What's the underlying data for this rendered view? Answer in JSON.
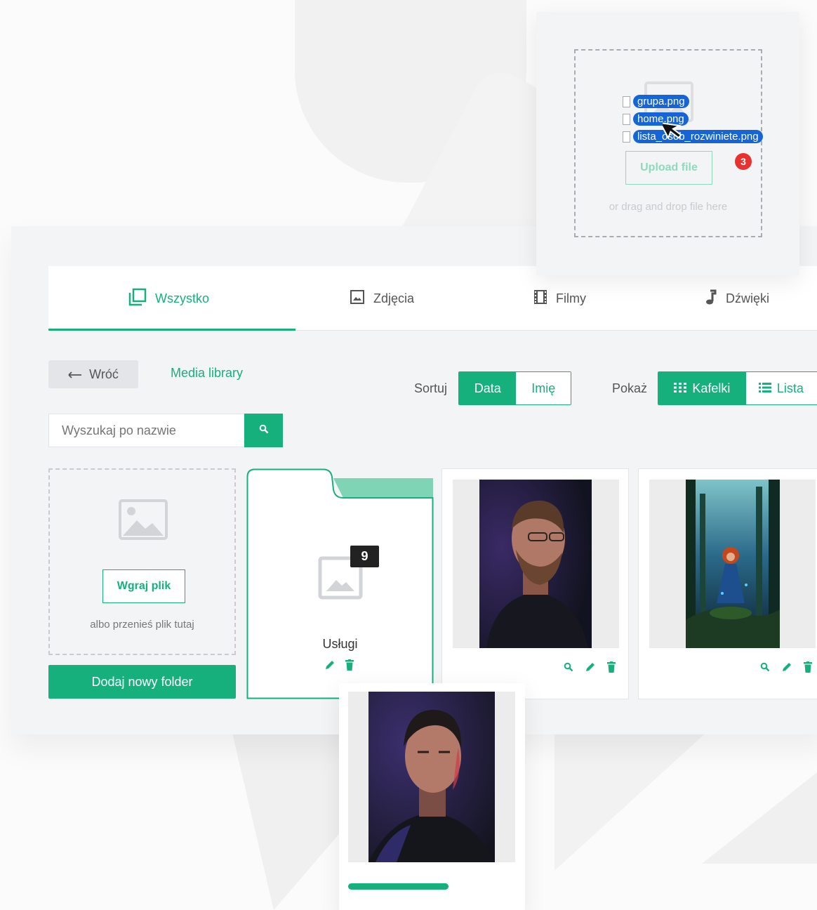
{
  "tabs": [
    {
      "label": "Wszystko",
      "icon": "copy-icon",
      "active": true
    },
    {
      "label": "Zdjęcia",
      "icon": "image-icon",
      "active": false
    },
    {
      "label": "Filmy",
      "icon": "film-icon",
      "active": false
    },
    {
      "label": "Dźwięki",
      "icon": "music-note-icon",
      "active": false
    }
  ],
  "toolbar": {
    "back_label": "Wróć",
    "breadcrumb": "Media library",
    "sort_label": "Sortuj",
    "sort_options": [
      {
        "label": "Data",
        "selected": true
      },
      {
        "label": "Imię",
        "selected": false
      }
    ],
    "show_label": "Pokaż",
    "view_options": [
      {
        "label": "Kafelki",
        "icon": "grid-icon",
        "selected": true
      },
      {
        "label": "Lista",
        "icon": "list-icon",
        "selected": false
      }
    ]
  },
  "search": {
    "placeholder": "Wyszukaj po nazwie",
    "value": ""
  },
  "upload": {
    "button_label": "Wgraj plik",
    "hint": "albo przenieś plik tutaj",
    "add_folder_label": "Dodaj nowy folder"
  },
  "folder": {
    "name": "Usługi",
    "count": "9"
  },
  "drop_popup": {
    "button_label": "Upload file",
    "hint": "or drag and drop file here",
    "dragged_files": [
      "grupa.png",
      "home.png",
      "lista_osob_rozwiniete.png"
    ],
    "dragged_count": "3"
  },
  "upload_progress": 0.6,
  "colors": {
    "accent": "#16b07c",
    "accent_light": "#8fd9bd",
    "badge_red": "#e8322f",
    "chip_blue": "#1565d8"
  }
}
